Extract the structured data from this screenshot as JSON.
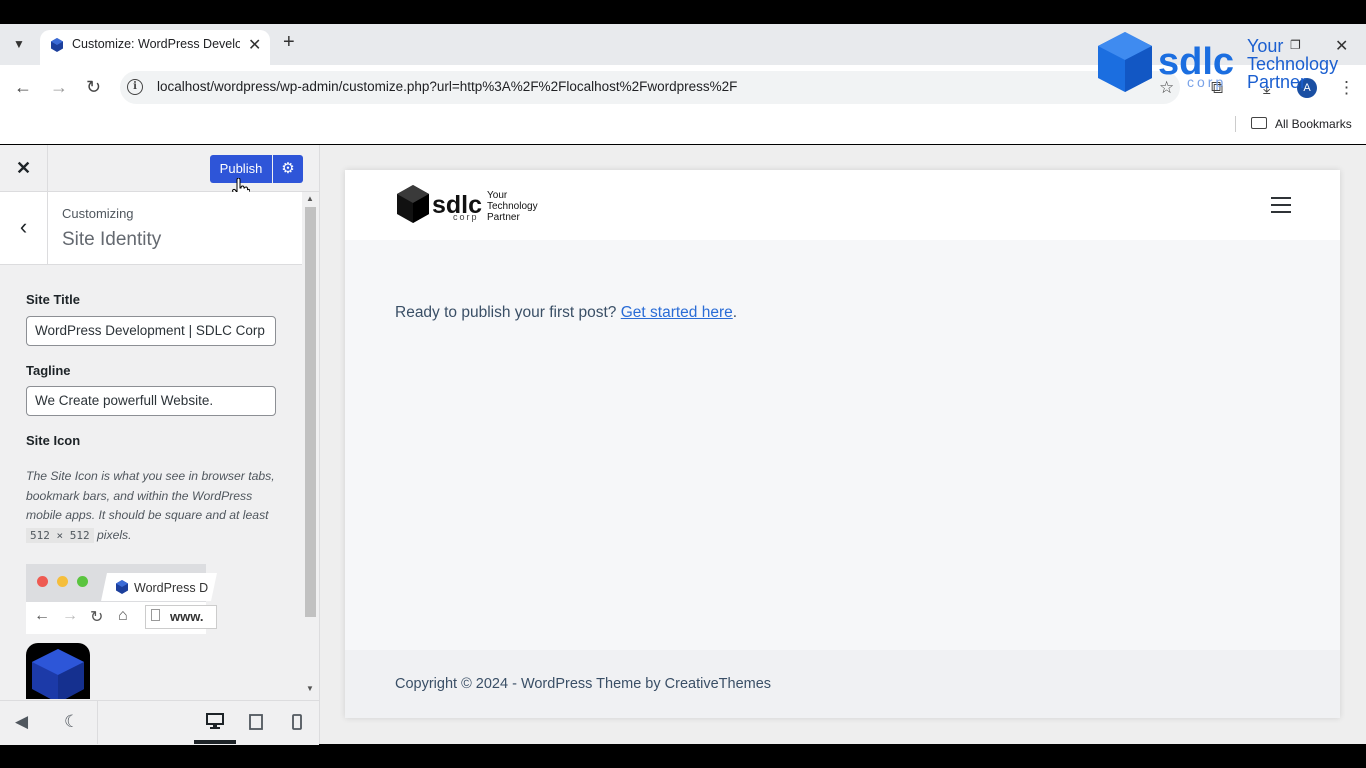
{
  "browser": {
    "tab_title": "Customize: WordPress Develop",
    "url": "localhost/wordpress/wp-admin/customize.php?url=http%3A%2F%2Flocalhost%2Fwordpress%2F",
    "avatar_letter": "A",
    "bookmarks_label": "All Bookmarks"
  },
  "watermark": {
    "brand": "sdlc",
    "corp": "corp",
    "tagline_1": "Your",
    "tagline_2": "Technology",
    "tagline_3": "Partner"
  },
  "customizer": {
    "publish_label": "Publish",
    "customizing_label": "Customizing",
    "section_title": "Site Identity",
    "site_title_label": "Site Title",
    "site_title_value": "WordPress Development | SDLC Corp",
    "tagline_label": "Tagline",
    "tagline_value": "We Create powerfull Website.",
    "site_icon_label": "Site Icon",
    "site_icon_desc_1": "The Site Icon is what you see in browser tabs, bookmark bars, and within the WordPress mobile apps. It should be square and at least ",
    "site_icon_size": "512 × 512",
    "site_icon_desc_2": " pixels.",
    "preview_tab_label": "WordPress D",
    "preview_url": "www."
  },
  "site": {
    "logo_brand": "sdlc",
    "logo_corp": "corp",
    "logo_tag_1": "Your",
    "logo_tag_2": "Technology",
    "logo_tag_3": "Partner",
    "content_text": "Ready to publish your first post? ",
    "content_link": "Get started here",
    "content_end": ".",
    "copyright": "Copyright © 2024 - WordPress Theme by CreativeThemes"
  },
  "colors": {
    "publish_blue": "#2e55d8",
    "link_blue": "#2a6cd6",
    "brand_blue": "#1b5fd0"
  }
}
